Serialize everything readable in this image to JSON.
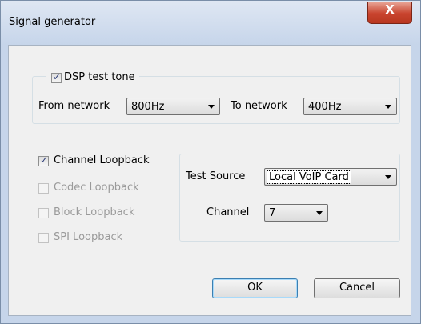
{
  "window": {
    "title": "Signal generator",
    "close_glyph": "X"
  },
  "dsp": {
    "checkbox_label": "DSP test tone",
    "checked": true,
    "from_label": "From network",
    "from_value": "800Hz",
    "to_label": "To network",
    "to_value": "400Hz"
  },
  "loopbacks": [
    {
      "label": "Channel Loopback",
      "checked": true,
      "enabled": true
    },
    {
      "label": "Codec Loopback",
      "checked": false,
      "enabled": false
    },
    {
      "label": "Block Loopback",
      "checked": false,
      "enabled": false
    },
    {
      "label": "SPI Loopback",
      "checked": false,
      "enabled": false
    }
  ],
  "test": {
    "source_label": "Test Source",
    "source_value": "Local VoIP Card",
    "channel_label": "Channel",
    "channel_value": "7"
  },
  "buttons": {
    "ok": "OK",
    "cancel": "Cancel"
  },
  "colors": {
    "close_button": "#c9442e",
    "frame": "#c6d5ea",
    "client": "#f0f0f0"
  }
}
